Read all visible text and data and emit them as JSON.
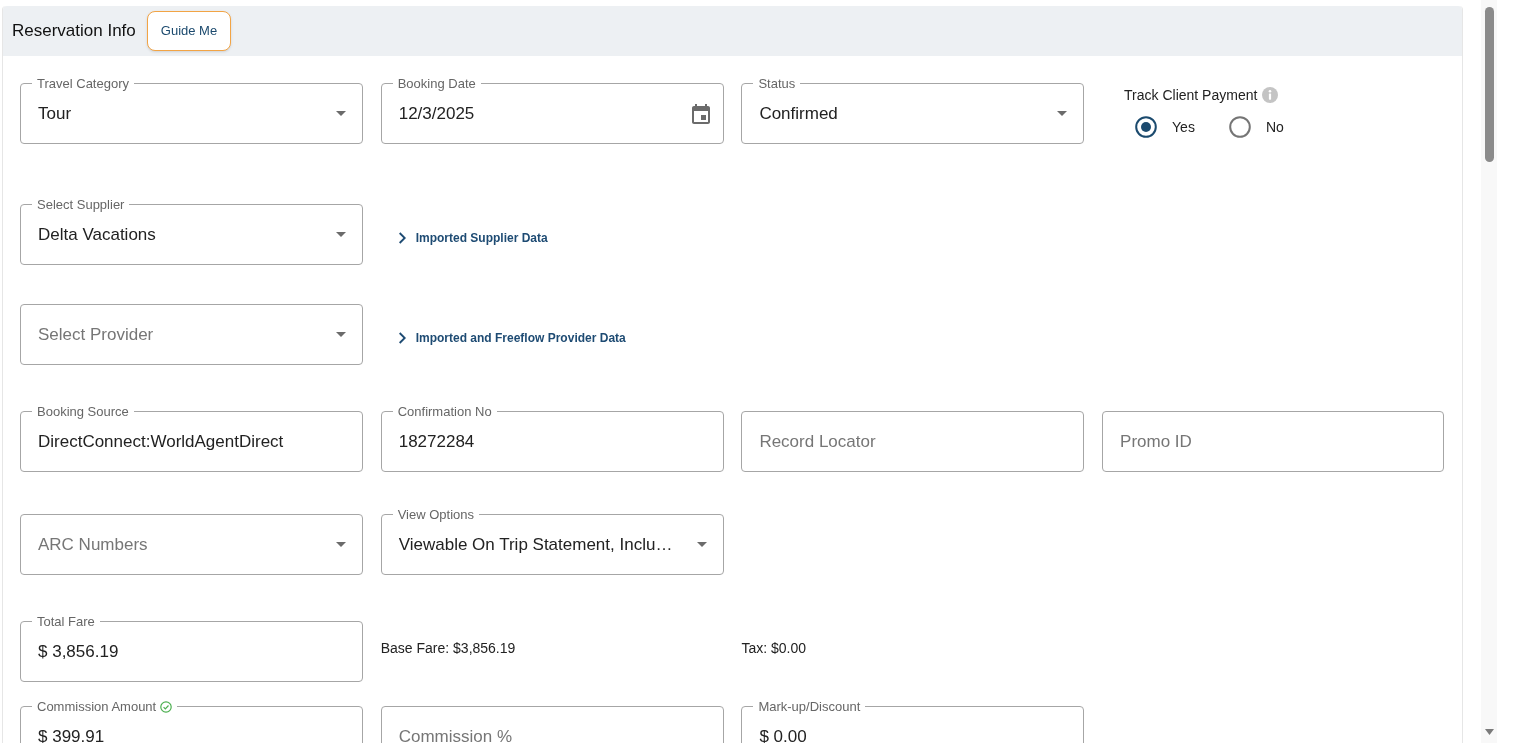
{
  "section": {
    "title": "Reservation Info",
    "guide_button": "Guide Me"
  },
  "form_rows": [
    {
      "items": [
        {
          "kind": "select",
          "label": "Travel Category",
          "value": "Tour"
        },
        {
          "kind": "date",
          "label": "Booking Date",
          "value": "12/3/2025"
        },
        {
          "kind": "select",
          "label": "Status",
          "value": "Confirmed"
        },
        {
          "kind": "radio_group",
          "label": "Track Client Payment",
          "options": [
            {
              "label": "Yes",
              "selected": true
            },
            {
              "label": "No",
              "selected": false
            }
          ]
        }
      ]
    },
    {
      "items": [
        {
          "kind": "select",
          "label": "Select Supplier",
          "value": "Delta Vacations"
        },
        {
          "kind": "link",
          "text": "Imported Supplier Data"
        }
      ]
    },
    {
      "items": [
        {
          "kind": "select",
          "placeholder": "Select Provider"
        },
        {
          "kind": "link",
          "text": "Imported and Freeflow Provider Data"
        }
      ]
    },
    {
      "items": [
        {
          "kind": "text",
          "label": "Booking Source",
          "value": "DirectConnect:WorldAgentDirect"
        },
        {
          "kind": "text",
          "label": "Confirmation No",
          "value": "18272284"
        },
        {
          "kind": "text",
          "placeholder": "Record Locator"
        },
        {
          "kind": "text",
          "placeholder": "Promo ID"
        }
      ]
    },
    {
      "items": [
        {
          "kind": "select",
          "placeholder": "ARC Numbers"
        },
        {
          "kind": "select",
          "label": "View Options",
          "value": "Viewable On Trip Statement, Inclu…"
        }
      ]
    },
    {
      "items": [
        {
          "kind": "text",
          "label": "Total Fare",
          "value": "$ 3,856.19"
        },
        {
          "kind": "note",
          "text": "Base Fare: $3,856.19"
        },
        {
          "kind": "note",
          "text": "Tax: $0.00"
        }
      ]
    },
    {
      "items": [
        {
          "kind": "text",
          "label": "Commission Amount",
          "verified": true,
          "value": "$ 399.91"
        },
        {
          "kind": "text",
          "placeholder": "Commission %"
        },
        {
          "kind": "text",
          "label": "Mark-up/Discount",
          "value": "$ 0.00"
        }
      ]
    }
  ]
}
